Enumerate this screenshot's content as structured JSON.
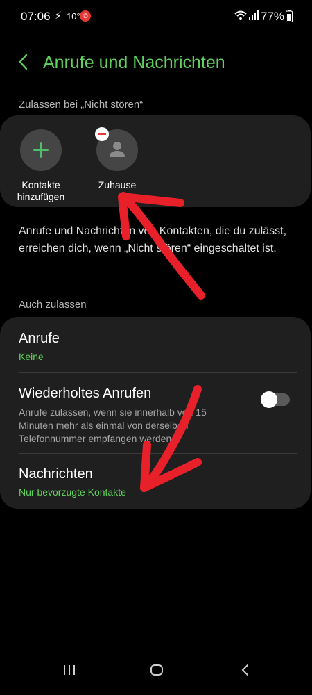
{
  "status_bar": {
    "time": "07:06",
    "temperature": "10°",
    "battery": "77%",
    "icons": [
      "flash-icon",
      "whatsapp-icon",
      "wifi-icon",
      "signal-icon",
      "battery-icon"
    ]
  },
  "header": {
    "back_icon": "chevron-left-icon",
    "title": "Anrufe und Nachrichten"
  },
  "allowed_section": {
    "label": "Zulassen bei „Nicht stören“",
    "contacts": [
      {
        "label": "Kontakte hinzufügen",
        "icon": "plus-icon"
      },
      {
        "label": "Zuhause",
        "icon": "person-icon",
        "badge": "remove-icon"
      }
    ]
  },
  "description": "Anrufe und Nachrichten von Kontakten, die du zulässt, erreichen dich, wenn „Nicht stören“ eingeschaltet ist.",
  "also_allow": {
    "label": "Auch zulassen",
    "rows": [
      {
        "title": "Anrufe",
        "value": "Keine"
      },
      {
        "title": "Wiederholtes Anrufen",
        "description": "Anrufe zulassen, wenn sie innerhalb von 15 Minuten mehr als einmal von derselben Telefonnummer empfangen werden.",
        "toggle_on": false
      },
      {
        "title": "Nachrichten",
        "value": "Nur bevorzugte Kontakte"
      }
    ]
  },
  "nav_bar": {
    "icons": [
      "recents-icon",
      "home-icon",
      "back-icon"
    ]
  },
  "colors": {
    "accent": "#62d05e",
    "card": "#1f1f1f",
    "annotation": "#e8202a"
  }
}
